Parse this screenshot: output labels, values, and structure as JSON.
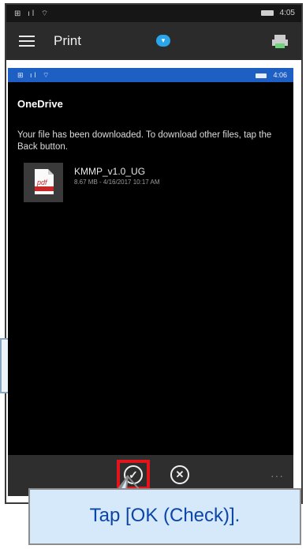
{
  "outer_status": {
    "left_icons": "⊞ ıl ⌔",
    "time": "4:05"
  },
  "appbar": {
    "title": "Print"
  },
  "inner_status": {
    "left_icons": "⊞ ıl ⌔",
    "time": "4:06"
  },
  "onedrive": {
    "title": "OneDrive",
    "message": "Your file has been downloaded. To download other files, tap the Back button.",
    "file": {
      "name": "KMMP_v1.0_UG",
      "meta": "8.67 MB - 4/16/2017 10:17 AM",
      "icon_label": "pdf"
    }
  },
  "cmdbar": {
    "ok_glyph": "✓",
    "cancel_glyph": "✕",
    "more": "···"
  },
  "callout": {
    "text": "Tap [OK (Check)]."
  },
  "colors": {
    "highlight": "#e2151b",
    "inner_status": "#1e5fc4",
    "callout_bg": "#d6e9fb",
    "callout_text": "#0c45a8"
  },
  "icons": [
    "hamburger-icon",
    "cloud-icon",
    "printer-icon",
    "pdf-file-icon",
    "check-circle-icon",
    "cancel-circle-icon",
    "more-icon"
  ]
}
